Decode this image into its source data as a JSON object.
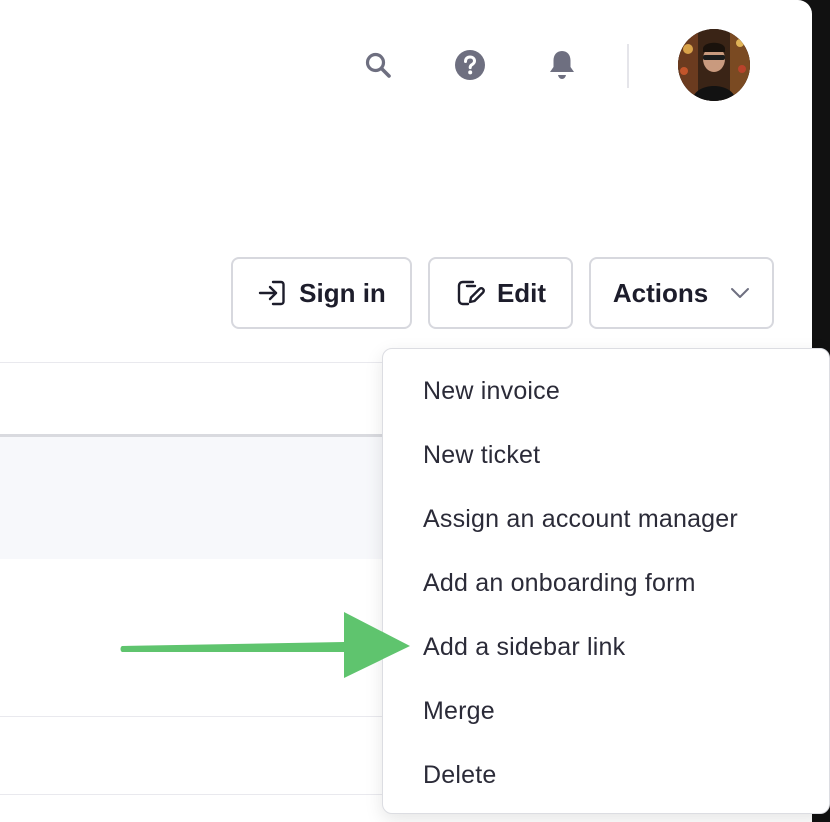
{
  "topbar": {
    "icons": [
      "search-icon",
      "help-icon",
      "bell-icon"
    ],
    "avatar_alt": "user-avatar"
  },
  "toolbar": {
    "signin_label": "Sign in",
    "edit_label": "Edit",
    "actions_label": "Actions"
  },
  "actions_menu": {
    "items": [
      {
        "label": "New invoice"
      },
      {
        "label": "New ticket"
      },
      {
        "label": "Assign an account manager"
      },
      {
        "label": "Add an onboarding form"
      },
      {
        "label": "Add a sidebar link"
      },
      {
        "label": "Merge"
      },
      {
        "label": "Delete"
      }
    ]
  },
  "colors": {
    "text": "#1d1d2b",
    "icon_gray": "#6e6f80",
    "border": "#d7d8de",
    "annotation_green": "#5fc46e"
  }
}
